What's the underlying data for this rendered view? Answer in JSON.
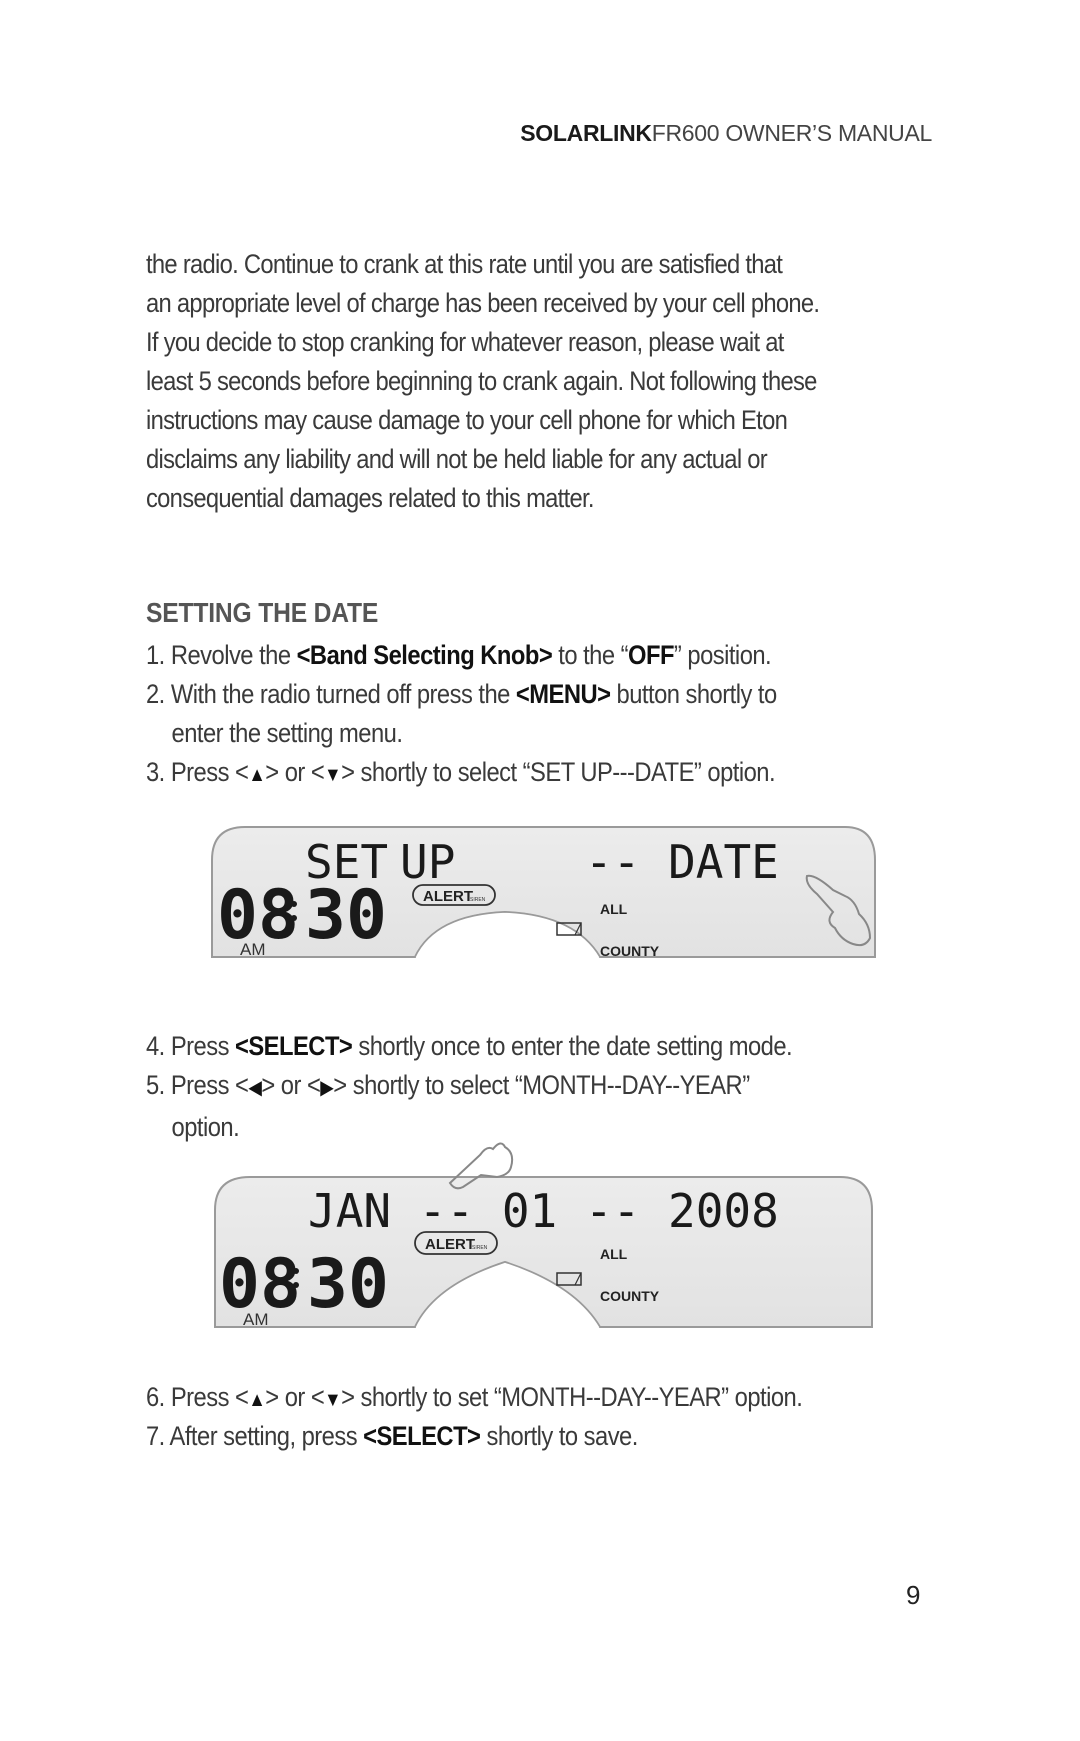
{
  "header": {
    "brand": "SOLARLINK",
    "title": "FR600 OWNER’S MANUAL"
  },
  "intro_paragraph": {
    "lines": [
      "the radio. Continue to crank at this rate until you are satisfied that",
      "an appropriate level of charge has been received by your cell phone.",
      "If you decide to stop cranking for whatever reason, please wait at",
      "least 5 seconds before beginning to crank again. Not following these",
      "instructions may cause damage to your cell phone for which Eton",
      "disclaims any liability and will not be held liable for any actual or",
      "consequential damages related to this matter."
    ]
  },
  "section": {
    "heading": "SETTING THE DATE",
    "steps": [
      {
        "num": "1.",
        "pre": "Revolve the ",
        "bold": "<Band Selecting Knob>",
        "mid": " to the “",
        "bold2": "OFF",
        "post": "” position."
      },
      {
        "num": "2.",
        "pre": "With the radio turned off press the ",
        "bold": "<MENU>",
        "post": " button shortly to",
        "cont": "enter the setting menu."
      },
      {
        "num": "3.",
        "pre": "Press <",
        "glyph1": "▲",
        "mid": "> or <",
        "glyph2": "▼",
        "post": "> shortly to select “SET UP---DATE” option."
      },
      {
        "num": "4.",
        "pre": "Press ",
        "bold": "<SELECT>",
        "post": " shortly once to enter the date setting mode."
      },
      {
        "num": "5.",
        "pre": "Press <",
        "glyph1": "◀",
        "mid": "> or <",
        "glyph2": "▶",
        "post": "> shortly to select “MONTH--DAY--YEAR”",
        "cont": "option."
      },
      {
        "num": "6.",
        "pre": "Press <",
        "glyph1": "▲",
        "mid": "> or <",
        "glyph2": "▼",
        "post": "> shortly to set “MONTH--DAY--YEAR” option."
      },
      {
        "num": "7.",
        "pre": "After setting, press ",
        "bold": "<SELECT>",
        "post": " shortly to save."
      }
    ]
  },
  "lcd_displays": [
    {
      "top_line_left": "SET",
      "top_line_mid": "UP",
      "top_line_right": "-- DATE",
      "time": "08:30",
      "hour": "08",
      "minute": "30",
      "meridiem": "AM",
      "alert_label": "ALERT",
      "alert_sub": "SIREN",
      "right_label_1": "ALL",
      "right_label_2": "COUNTY",
      "icons": [
        "battery-icon",
        "pointing-hand-icon"
      ]
    },
    {
      "top_line": "JAN -- 01 -- 2008",
      "hour": "08",
      "minute": "30",
      "meridiem": "AM",
      "alert_label": "ALERT",
      "alert_sub": "SIREN",
      "right_label_1": "ALL",
      "right_label_2": "COUNTY",
      "icons": [
        "battery-icon",
        "pointing-hand-icon"
      ]
    }
  ],
  "page_number": "9",
  "colors": {
    "text": "#3a3a3a",
    "heading": "#555555",
    "lcd_background": "#e6e6e6",
    "lcd_border": "#9a9a9a",
    "lcd_segment": "#1a1a1a"
  }
}
